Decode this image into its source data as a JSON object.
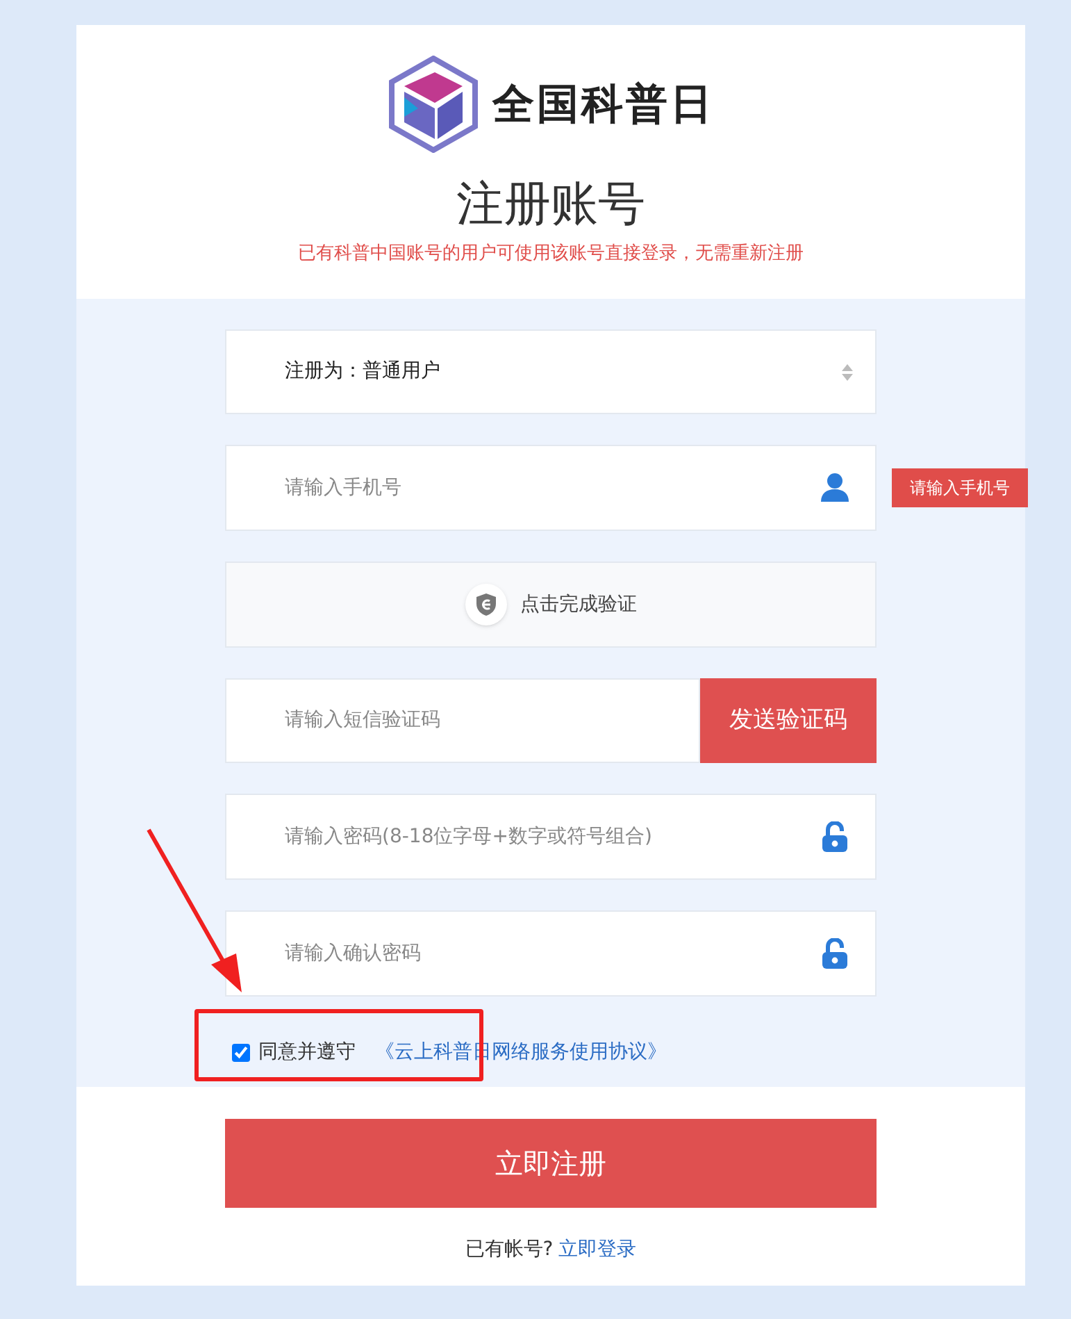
{
  "logo": {
    "text": "全国科普日"
  },
  "title": "注册账号",
  "notice": "已有科普中国账号的用户可使用该账号直接登录，无需重新注册",
  "fields": [
    {
      "kind": "select",
      "value": "注册为：普通用户"
    },
    {
      "kind": "phone",
      "placeholder": "请输入手机号",
      "error": "请输入手机号"
    },
    {
      "kind": "captcha",
      "label": "点击完成验证"
    },
    {
      "kind": "code",
      "placeholder": "请输入短信验证码",
      "button": "发送验证码"
    },
    {
      "kind": "password",
      "placeholder": "请输入密码(8-18位字母+数字或符号组合)"
    },
    {
      "kind": "password",
      "placeholder": "请输入确认密码"
    }
  ],
  "agreement": {
    "checked": true,
    "text": "同意并遵守",
    "link": "《云上科普日网络服务使用协议》"
  },
  "submit": "立即注册",
  "login": {
    "text": "已有帐号?",
    "link": "立即登录"
  }
}
